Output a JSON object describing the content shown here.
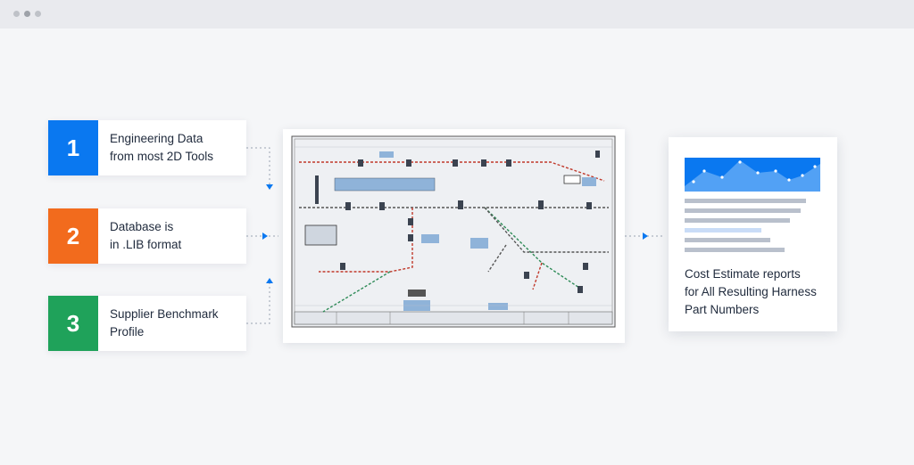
{
  "steps": [
    {
      "number": "1",
      "line1": "Engineering Data",
      "line2": "from most 2D Tools",
      "color": "#0a78f0"
    },
    {
      "number": "2",
      "line1": "Database is",
      "line2": "in .LIB format",
      "color": "#f26b1d"
    },
    {
      "number": "3",
      "line1": "Supplier Benchmark",
      "line2": "Profile",
      "color": "#1fa25a"
    }
  ],
  "report": {
    "line1": "Cost Estimate reports",
    "line2": "for All Resulting Harness",
    "line3": "Part Numbers"
  },
  "colors": {
    "accent": "#0a78f0",
    "connector": "#9aa4b2"
  }
}
